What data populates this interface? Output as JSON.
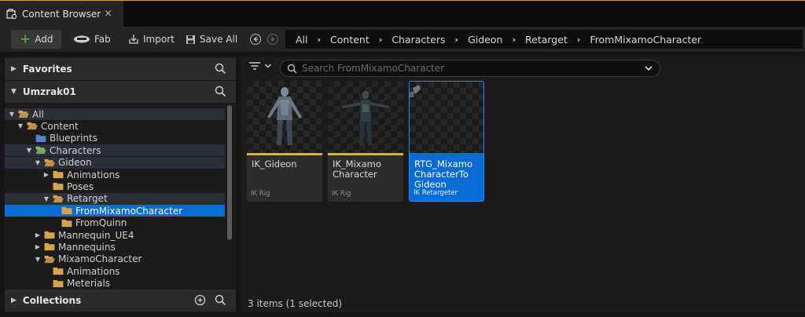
{
  "tab": {
    "label": "Content Browser",
    "close": "×"
  },
  "toolbar": {
    "add_label": "Add",
    "fab_label": "Fab",
    "import_label": "Import",
    "saveall_label": "Save All",
    "breadcrumb": [
      "All",
      "Content",
      "Characters",
      "Gideon",
      "Retarget",
      "FromMixamoCharacter"
    ],
    "breadcrumb_sep": "›"
  },
  "left": {
    "favorites": "Favorites",
    "project": "Umzrak01",
    "collections": "Collections",
    "tree": [
      {
        "label": "All",
        "depth": 0,
        "expanded": true,
        "open": true,
        "alt": true
      },
      {
        "label": "Content",
        "depth": 1,
        "expanded": true,
        "open": true,
        "alt": false
      },
      {
        "label": "Blueprints",
        "depth": 2,
        "expanded": false,
        "leaf": true,
        "color": "#5b7fc9",
        "alt": false
      },
      {
        "label": "Characters",
        "depth": 2,
        "expanded": true,
        "open": true,
        "color": "#7fbf6a",
        "alt": true
      },
      {
        "label": "Gideon",
        "depth": 3,
        "expanded": true,
        "open": true,
        "alt": true
      },
      {
        "label": "Animations",
        "depth": 4,
        "expanded": false,
        "alt": false
      },
      {
        "label": "Poses",
        "depth": 4,
        "expanded": false,
        "leaf": true,
        "alt": false
      },
      {
        "label": "Retarget",
        "depth": 4,
        "expanded": true,
        "open": true,
        "alt": true
      },
      {
        "label": "FromMixamoCharacter",
        "depth": 5,
        "expanded": false,
        "leaf": true,
        "selected": true
      },
      {
        "label": "FromQuinn",
        "depth": 5,
        "expanded": false,
        "leaf": true,
        "alt": false
      },
      {
        "label": "Mannequin_UE4",
        "depth": 3,
        "expanded": false,
        "alt": false
      },
      {
        "label": "Mannequins",
        "depth": 3,
        "expanded": false,
        "alt": false
      },
      {
        "label": "MixamoCharacter",
        "depth": 3,
        "expanded": true,
        "open": true,
        "alt": false
      },
      {
        "label": "Animations",
        "depth": 4,
        "expanded": false,
        "leaf": true,
        "alt": false
      },
      {
        "label": "Meterials",
        "depth": 4,
        "expanded": false,
        "leaf": true,
        "alt": false
      }
    ]
  },
  "right": {
    "search_placeholder": "Search FromMixamoCharacter",
    "assets": [
      {
        "name": "IK_Gideon",
        "type": "IK Rig",
        "selected": false
      },
      {
        "name": "IK_Mixamo Character",
        "type": "IK Rig",
        "selected": false
      },
      {
        "name": "RTG_Mixamo CharacterTo Gideon",
        "type": "IK Retargeter",
        "selected": true
      }
    ],
    "status": "3 items (1 selected)"
  },
  "colors": {
    "accent": "#0a6bd6",
    "folder": "#d8a44a",
    "asset_bar": "#e7b30c",
    "add_green": "#67b34a"
  }
}
